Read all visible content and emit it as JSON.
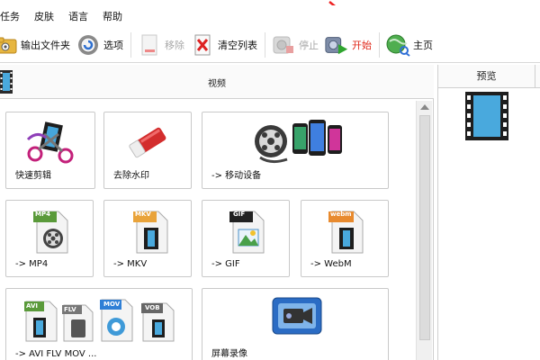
{
  "menu": {
    "items": [
      "任务",
      "皮肤",
      "语言",
      "帮助"
    ]
  },
  "toolbar": {
    "output_folder": "输出文件夹",
    "options": "选项",
    "remove": "移除",
    "clear_list": "清空列表",
    "stop": "停止",
    "start": "开始",
    "home": "主页"
  },
  "left": {
    "header_title": "视频",
    "tiles": [
      {
        "label": "快速剪辑",
        "icon": "scissors-film-icon"
      },
      {
        "label": "去除水印",
        "icon": "eraser-icon"
      },
      {
        "label": "-> 移动设备",
        "icon": "mobile-devices-icon"
      },
      {
        "label": "-> MP4",
        "icon": "mp4-file-icon",
        "badge": "MP4"
      },
      {
        "label": "-> MKV",
        "icon": "mkv-file-icon",
        "badge": "MKV"
      },
      {
        "label": "-> GIF",
        "icon": "gif-file-icon",
        "badge": "GIF"
      },
      {
        "label": "-> WebM",
        "icon": "webm-file-icon",
        "badge": "webm"
      },
      {
        "label": "-> AVI FLV MOV ...",
        "icon": "multi-format-icon",
        "badges": [
          "AVI",
          "FLV",
          "MOV",
          "VOB"
        ]
      },
      {
        "label": "屏幕录像",
        "icon": "screen-record-icon"
      }
    ]
  },
  "right": {
    "header": "预览"
  },
  "colors": {
    "accent_red": "#e0281a",
    "film_blue": "#3aa6d8"
  }
}
